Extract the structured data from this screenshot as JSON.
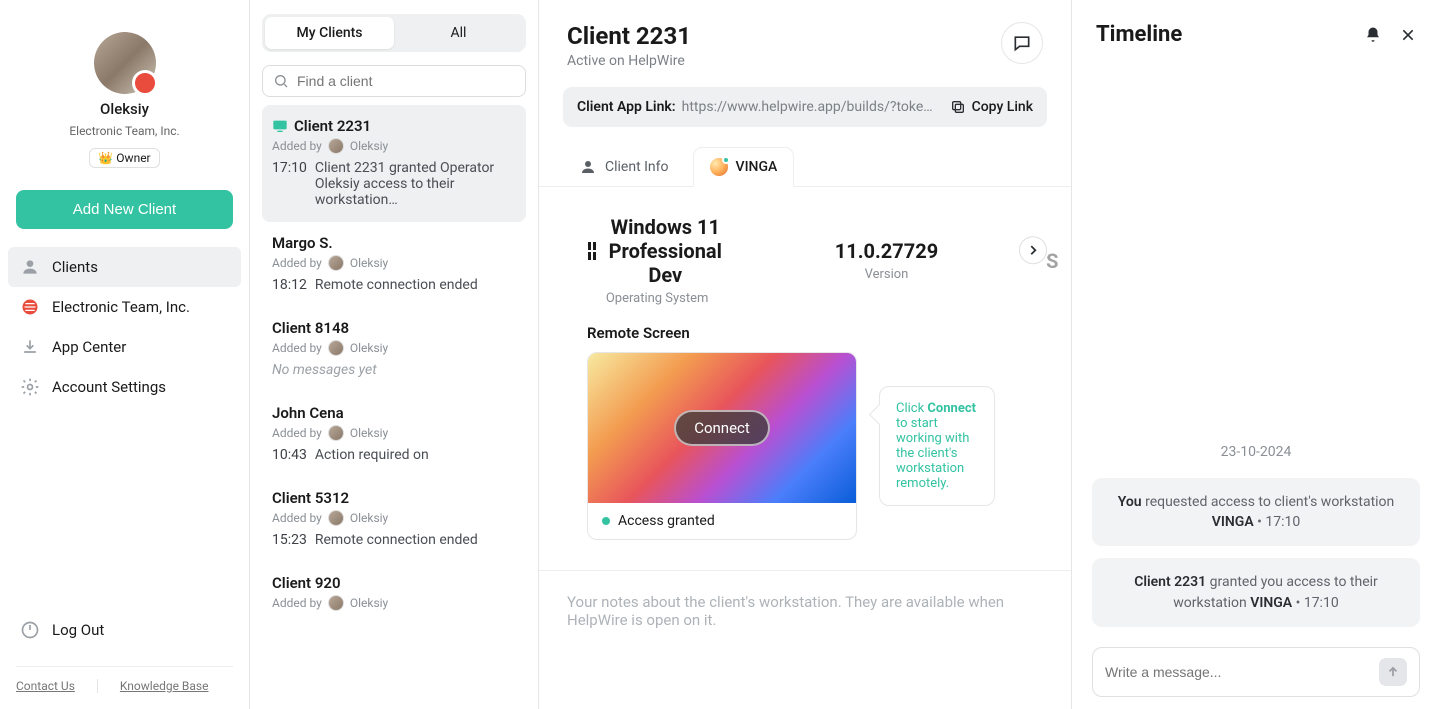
{
  "sidebar": {
    "owner_name": "Oleksiy",
    "team": "Electronic Team, Inc.",
    "owner_badge": "👑 Owner",
    "add_client": "Add New Client",
    "nav": {
      "clients": "Clients",
      "org": "Electronic Team, Inc.",
      "appcenter": "App Center",
      "settings": "Account Settings"
    },
    "logout": "Log Out",
    "contact": "Contact Us",
    "kb": "Knowledge Base"
  },
  "clients_panel": {
    "tab_my": "My Clients",
    "tab_all": "All",
    "search_placeholder": "Find a client",
    "items": [
      {
        "title": "Client 2231",
        "added_by_label": "Added by",
        "added_by": "Oleksiy",
        "time": "17:10",
        "text": "Client 2231 granted Operator Oleksiy access to their workstation…"
      },
      {
        "title": "Margo S.",
        "added_by_label": "Added by",
        "added_by": "Oleksiy",
        "time": "18:12",
        "text": "Remote connection ended"
      },
      {
        "title": "Client 8148",
        "added_by_label": "Added by",
        "added_by": "Oleksiy",
        "time": "",
        "text": "No messages yet"
      },
      {
        "title": "John Cena",
        "added_by_label": "Added by",
        "added_by": "Oleksiy",
        "time": "10:43",
        "text": "Action required on"
      },
      {
        "title": "Client 5312",
        "added_by_label": "Added by",
        "added_by": "Oleksiy",
        "time": "15:23",
        "text": "Remote connection ended"
      },
      {
        "title": "Client 920",
        "added_by_label": "Added by",
        "added_by": "Oleksiy",
        "time": "",
        "text": ""
      }
    ]
  },
  "main": {
    "title": "Client 2231",
    "subtitle": "Active on HelpWire",
    "link_label": "Client App Link:",
    "link_url": "https://www.helpwire.app/builds/?toke…",
    "copy": "Copy Link",
    "tab_info": "Client Info",
    "tab_vinga": "VINGA",
    "os_name": "Windows 11 Professional Dev",
    "os_label": "Operating System",
    "version": "11.0.27729",
    "version_label": "Version",
    "next_hint": "S",
    "remote_heading": "Remote Screen",
    "connect": "Connect",
    "status": "Access granted",
    "tip_pre": "Click ",
    "tip_bold": "Connect",
    "tip_post": " to start working with the client's workstation remotely.",
    "notes": "Your notes about the client's workstation. They are available when HelpWire is open on it."
  },
  "timeline": {
    "title": "Timeline",
    "date": "23-10-2024",
    "ev1_a": "You",
    "ev1_b": " requested access to client's workstation ",
    "ev1_c": "VINGA",
    "ev1_d": " • 17:10",
    "ev2_a": "Client 2231",
    "ev2_b": " granted you access to their workstation ",
    "ev2_c": "VINGA",
    "ev2_d": " • 17:10",
    "compose_placeholder": "Write a message..."
  }
}
